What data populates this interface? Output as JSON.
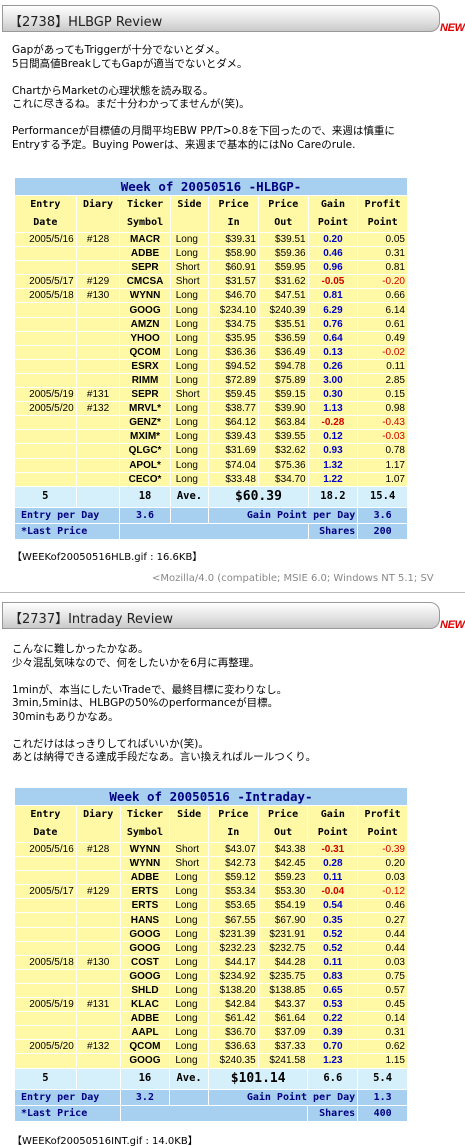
{
  "post1": {
    "title": "【2738】HLBGP Review",
    "new_badge": "NEW",
    "lines": [
      "GapがあってもTriggerが十分でないとダメ。",
      "5日間高値BreakしてもGapが適当でないとダメ。",
      "",
      "ChartからMarketの心理状態を読み取る。",
      "これに尽きるね。まだ十分わかってませんが(笑)。",
      "",
      "Performanceが目標値の月間平均EBW PP/T>0.8を下回ったので、来週は慎重に",
      "Entryする予定。Buying Powerは、来週まで基本的にはNo Careのrule."
    ],
    "table": {
      "title": "Week of 20050516 -HLBGP-",
      "headers": [
        [
          "Entry",
          "Date"
        ],
        [
          "Diary",
          ""
        ],
        [
          "Ticker",
          "Symbol"
        ],
        [
          "Side",
          ""
        ],
        [
          "Price",
          "In"
        ],
        [
          "Price",
          "Out"
        ],
        [
          "Gain",
          "Point"
        ],
        [
          "Profit",
          "Point"
        ]
      ],
      "rows": [
        {
          "date": "2005/5/16",
          "diary": "#128",
          "sym": "MACR",
          "side": "Long",
          "in": "$39.31",
          "out": "$39.51",
          "gain": "0.20",
          "profit": "0.05",
          "sep": true
        },
        {
          "date": "",
          "diary": "",
          "sym": "ADBE",
          "side": "Long",
          "in": "$58.90",
          "out": "$59.36",
          "gain": "0.46",
          "profit": "0.31"
        },
        {
          "date": "",
          "diary": "",
          "sym": "SEPR",
          "side": "Short",
          "in": "$60.91",
          "out": "$59.95",
          "gain": "0.96",
          "profit": "0.81"
        },
        {
          "date": "2005/5/17",
          "diary": "#129",
          "sym": "CMCSA",
          "side": "Short",
          "in": "$31.57",
          "out": "$31.62",
          "gain": "-0.05",
          "profit": "-0.20",
          "sep": true,
          "neg": true
        },
        {
          "date": "2005/5/18",
          "diary": "#130",
          "sym": "WYNN",
          "side": "Long",
          "in": "$46.70",
          "out": "$47.51",
          "gain": "0.81",
          "profit": "0.66",
          "sep": true
        },
        {
          "date": "",
          "diary": "",
          "sym": "GOOG",
          "side": "Long",
          "in": "$234.10",
          "out": "$240.39",
          "gain": "6.29",
          "profit": "6.14"
        },
        {
          "date": "",
          "diary": "",
          "sym": "AMZN",
          "side": "Long",
          "in": "$34.75",
          "out": "$35.51",
          "gain": "0.76",
          "profit": "0.61"
        },
        {
          "date": "",
          "diary": "",
          "sym": "YHOO",
          "side": "Long",
          "in": "$35.95",
          "out": "$36.59",
          "gain": "0.64",
          "profit": "0.49"
        },
        {
          "date": "",
          "diary": "",
          "sym": "QCOM",
          "side": "Long",
          "in": "$36.36",
          "out": "$36.49",
          "gain": "0.13",
          "profit": "-0.02",
          "negp": true
        },
        {
          "date": "",
          "diary": "",
          "sym": "ESRX",
          "side": "Long",
          "in": "$94.52",
          "out": "$94.78",
          "gain": "0.26",
          "profit": "0.11"
        },
        {
          "date": "",
          "diary": "",
          "sym": "RIMM",
          "side": "Long",
          "in": "$72.89",
          "out": "$75.89",
          "gain": "3.00",
          "profit": "2.85"
        },
        {
          "date": "2005/5/19",
          "diary": "#131",
          "sym": "SEPR",
          "side": "Short",
          "in": "$59.45",
          "out": "$59.15",
          "gain": "0.30",
          "profit": "0.15",
          "sep": true
        },
        {
          "date": "2005/5/20",
          "diary": "#132",
          "sym": "MRVL*",
          "side": "Long",
          "in": "$38.77",
          "out": "$39.90",
          "gain": "1.13",
          "profit": "0.98",
          "sep": true
        },
        {
          "date": "",
          "diary": "",
          "sym": "GENZ*",
          "side": "Long",
          "in": "$64.12",
          "out": "$63.84",
          "gain": "-0.28",
          "profit": "-0.43",
          "neg": true
        },
        {
          "date": "",
          "diary": "",
          "sym": "MXIM*",
          "side": "Long",
          "in": "$39.43",
          "out": "$39.55",
          "gain": "0.12",
          "profit": "-0.03",
          "negp": true
        },
        {
          "date": "",
          "diary": "",
          "sym": "QLGC*",
          "side": "Long",
          "in": "$31.69",
          "out": "$32.62",
          "gain": "0.93",
          "profit": "0.78"
        },
        {
          "date": "",
          "diary": "",
          "sym": "APOL*",
          "side": "Long",
          "in": "$74.04",
          "out": "$75.36",
          "gain": "1.32",
          "profit": "1.17"
        },
        {
          "date": "",
          "diary": "",
          "sym": "CECO*",
          "side": "Long",
          "in": "$33.48",
          "out": "$34.70",
          "gain": "1.22",
          "profit": "1.07"
        }
      ],
      "total": {
        "days": "5",
        "trades": "18",
        "ave_label": "Ave.",
        "ave": "$60.39",
        "gain": "18.2",
        "profit": "15.4"
      },
      "footer1": {
        "left_label": "Entry per Day",
        "left_value": "3.6",
        "right_label": "Gain Point per Day",
        "right_value": "3.6"
      },
      "footer2": {
        "left_label": "*Last Price",
        "right_label": "Shares",
        "right_value": "200"
      }
    },
    "caption": "【WEEKof20050516HLB.gif : 16.6KB】",
    "user_agent": "<Mozilla/4.0 (compatible; MSIE 6.0; Windows NT 5.1; SV"
  },
  "post2": {
    "title": "【2737】Intraday Review",
    "new_badge": "NEW",
    "lines": [
      "こんなに難しかったかなあ。",
      "少々混乱気味なので、何をしたいかを6月に再整理。",
      "",
      "1minが、本当にしたいTradeで、最終目標に変わりなし。",
      "3min,5minは、HLBGPの50%のperformanceが目標。",
      "30minもありかなあ。",
      "",
      "これだけははっきりしてればいいか(笑)。",
      "あとは納得できる達成手段だなあ。言い換えればルールつくり。"
    ],
    "table": {
      "title": "Week of 20050516 -Intraday-",
      "headers": [
        [
          "Entry",
          "Date"
        ],
        [
          "Diary",
          ""
        ],
        [
          "Ticker",
          "Symbol"
        ],
        [
          "Side",
          ""
        ],
        [
          "Price",
          "In"
        ],
        [
          "Price",
          "Out"
        ],
        [
          "Gain",
          "Point"
        ],
        [
          "Profit",
          "Point"
        ]
      ],
      "rows": [
        {
          "date": "2005/5/16",
          "diary": "#128",
          "sym": "WYNN",
          "side": "Short",
          "in": "$43.07",
          "out": "$43.38",
          "gain": "-0.31",
          "profit": "-0.39",
          "sep": true,
          "neg": true
        },
        {
          "date": "",
          "diary": "",
          "sym": "WYNN",
          "side": "Short",
          "in": "$42.73",
          "out": "$42.45",
          "gain": "0.28",
          "profit": "0.20"
        },
        {
          "date": "",
          "diary": "",
          "sym": "ADBE",
          "side": "Long",
          "in": "$59.12",
          "out": "$59.23",
          "gain": "0.11",
          "profit": "0.03"
        },
        {
          "date": "2005/5/17",
          "diary": "#129",
          "sym": "ERTS",
          "side": "Long",
          "in": "$53.34",
          "out": "$53.30",
          "gain": "-0.04",
          "profit": "-0.12",
          "sep": true,
          "neg": true
        },
        {
          "date": "",
          "diary": "",
          "sym": "ERTS",
          "side": "Long",
          "in": "$53.65",
          "out": "$54.19",
          "gain": "0.54",
          "profit": "0.46"
        },
        {
          "date": "",
          "diary": "",
          "sym": "HANS",
          "side": "Long",
          "in": "$67.55",
          "out": "$67.90",
          "gain": "0.35",
          "profit": "0.27"
        },
        {
          "date": "",
          "diary": "",
          "sym": "GOOG",
          "side": "Long",
          "in": "$231.39",
          "out": "$231.91",
          "gain": "0.52",
          "profit": "0.44"
        },
        {
          "date": "",
          "diary": "",
          "sym": "GOOG",
          "side": "Long",
          "in": "$232.23",
          "out": "$232.75",
          "gain": "0.52",
          "profit": "0.44"
        },
        {
          "date": "2005/5/18",
          "diary": "#130",
          "sym": "COST",
          "side": "Long",
          "in": "$44.17",
          "out": "$44.28",
          "gain": "0.11",
          "profit": "0.03",
          "sep": true
        },
        {
          "date": "",
          "diary": "",
          "sym": "GOOG",
          "side": "Long",
          "in": "$234.92",
          "out": "$235.75",
          "gain": "0.83",
          "profit": "0.75"
        },
        {
          "date": "",
          "diary": "",
          "sym": "SHLD",
          "side": "Long",
          "in": "$138.20",
          "out": "$138.85",
          "gain": "0.65",
          "profit": "0.57"
        },
        {
          "date": "2005/5/19",
          "diary": "#131",
          "sym": "KLAC",
          "side": "Long",
          "in": "$42.84",
          "out": "$43.37",
          "gain": "0.53",
          "profit": "0.45",
          "sep": true
        },
        {
          "date": "",
          "diary": "",
          "sym": "ADBE",
          "side": "Long",
          "in": "$61.42",
          "out": "$61.64",
          "gain": "0.22",
          "profit": "0.14"
        },
        {
          "date": "",
          "diary": "",
          "sym": "AAPL",
          "side": "Long",
          "in": "$36.70",
          "out": "$37.09",
          "gain": "0.39",
          "profit": "0.31"
        },
        {
          "date": "2005/5/20",
          "diary": "#132",
          "sym": "QCOM",
          "side": "Long",
          "in": "$36.63",
          "out": "$37.33",
          "gain": "0.70",
          "profit": "0.62",
          "sep": true
        },
        {
          "date": "",
          "diary": "",
          "sym": "GOOG",
          "side": "Long",
          "in": "$240.35",
          "out": "$241.58",
          "gain": "1.23",
          "profit": "1.15"
        }
      ],
      "total": {
        "days": "5",
        "trades": "16",
        "ave_label": "Ave.",
        "ave": "$101.14",
        "gain": "6.6",
        "profit": "5.4"
      },
      "footer1": {
        "left_label": "Entry per Day",
        "left_value": "3.2",
        "right_label": "Gain Point per Day",
        "right_value": "1.3"
      },
      "footer2": {
        "left_label": "*Last Price",
        "right_label": "Shares",
        "right_value": "400"
      }
    },
    "caption": "【WEEKof20050516INT.gif : 14.0KB】"
  },
  "colors": {
    "header_blue": "#a7cff0",
    "row_yellow": "#fff9a6",
    "total_cyan": "#d6f0fb",
    "gain_blue": "#0000cc",
    "loss_red": "#d00000",
    "new_red": "#e00000"
  }
}
